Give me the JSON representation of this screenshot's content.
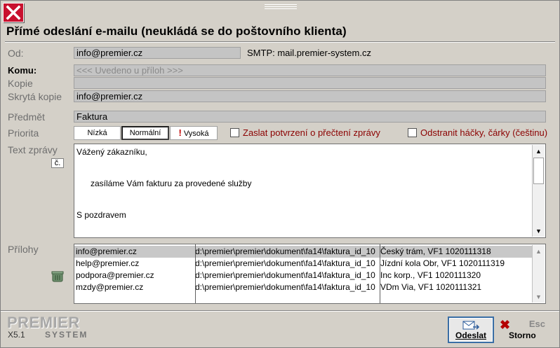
{
  "window": {
    "title": "Přímé odeslání e-mailu (neukládá se do poštovního klienta)"
  },
  "form": {
    "od_label": "Od:",
    "od_value": "info@premier.cz",
    "smtp_text": "SMTP: mail.premier-system.cz",
    "komu_label": "Komu:",
    "komu_placeholder": "<<< Uvedeno u příloh >>>",
    "kopie_label": "Kopie",
    "kopie_value": "",
    "skryta_label": "Skrytá kopie",
    "skryta_value": "info@premier.cz",
    "predmet_label": "Předmět",
    "predmet_value": "Faktura",
    "priorita_label": "Priorita",
    "priority": {
      "low": "Nízká",
      "normal": "Normální",
      "high": "Vysoká",
      "selected": "Normální"
    },
    "read_receipt_label": "Zaslat potvrzení o přečtení zprávy",
    "read_receipt_checked": false,
    "strip_diacritics_label": "Odstranit háčky, čárky (češtinu)",
    "strip_diacritics_checked": false,
    "text_label": "Text zprávy",
    "cz_button": "č.",
    "message_lines": [
      "Vážený zákazníku,",
      "",
      "",
      "      zasíláme Vám fakturu za provedené služby",
      "",
      "",
      "S pozdravem"
    ],
    "attachments_label": "Přílohy",
    "attachments": [
      {
        "email": "info@premier.cz",
        "path": "d:\\premier\\premier\\dokument\\fa14\\faktura_id_10",
        "desc": "Český trám, VF1 1020111318",
        "selected": true
      },
      {
        "email": "help@premier.cz",
        "path": "d:\\premier\\premier\\dokument\\fa14\\faktura_id_10",
        "desc": "Jízdní kola Obr, VF1 1020111319",
        "selected": false
      },
      {
        "email": "podpora@premier.cz",
        "path": "d:\\premier\\premier\\dokument\\fa14\\faktura_id_10",
        "desc": "Inc korp., VF1 1020111320",
        "selected": false
      },
      {
        "email": "mzdy@premier.cz",
        "path": "d:\\premier\\premier\\dokument\\fa14\\faktura_id_10",
        "desc": "VDm Via, VF1 1020111321",
        "selected": false
      }
    ]
  },
  "footer": {
    "logo_text": "PREMIER",
    "version": "X5.1",
    "logo_sub": "SYSTEM",
    "send_label": "Odeslat",
    "cancel_label": "Storno",
    "cancel_key": "Esc"
  },
  "colors": {
    "close_red": "#c8102e",
    "checkbox_label": "#8b0000",
    "send_border": "#3a6ea5"
  }
}
